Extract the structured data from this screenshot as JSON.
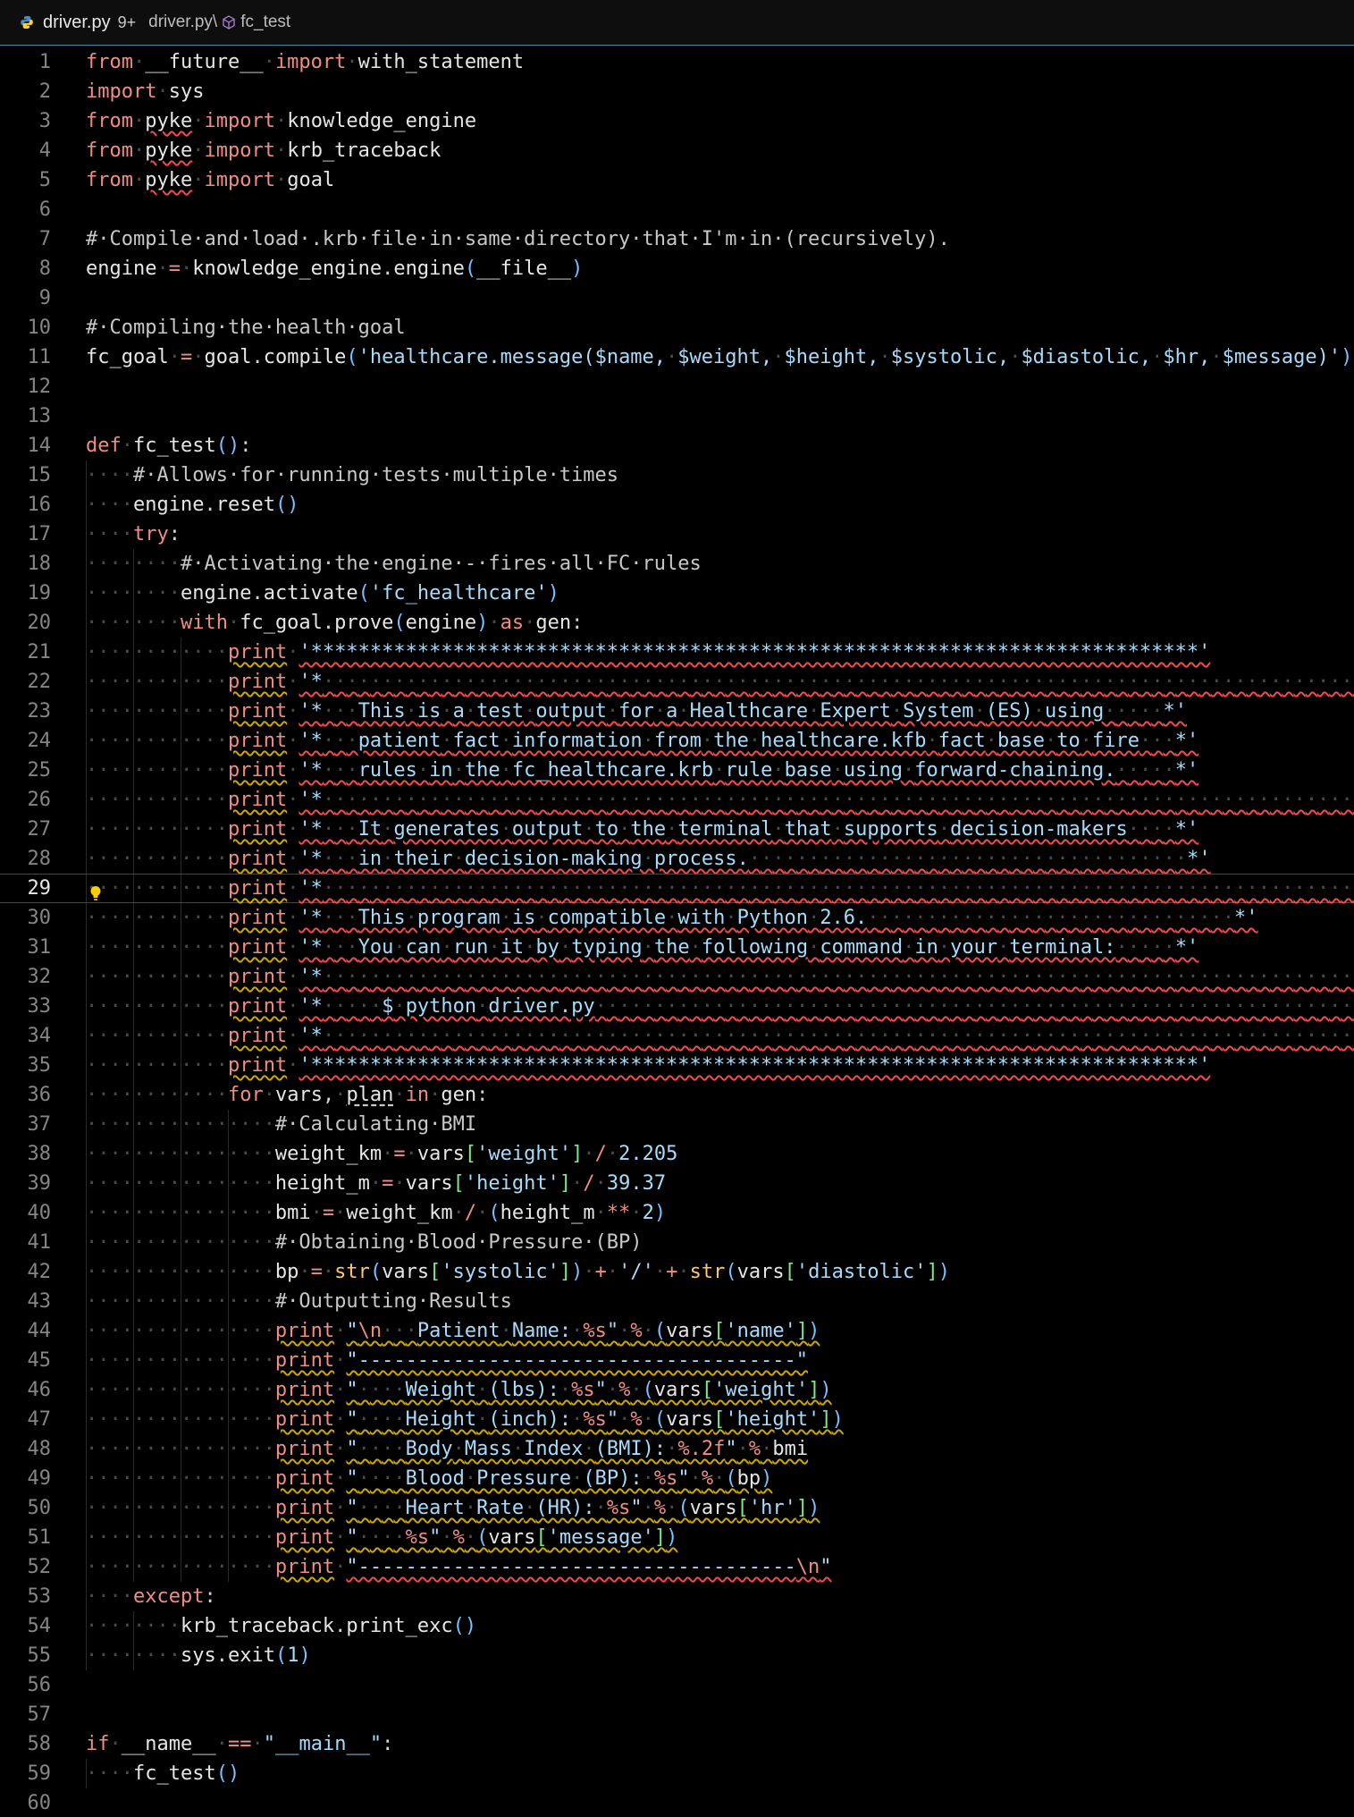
{
  "breadcrumb": {
    "file": "driver.py",
    "badge": "9+",
    "path": "driver.py\\",
    "symbol": "fc_test"
  },
  "editor": {
    "current_line": 29,
    "lines": [
      {
        "n": "1",
        "text": "from·__future__·import·with_statement"
      },
      {
        "n": "2",
        "text": "import·sys"
      },
      {
        "n": "3",
        "text": "from·pyke·import·knowledge_engine"
      },
      {
        "n": "4",
        "text": "from·pyke·import·krb_traceback"
      },
      {
        "n": "5",
        "text": "from·pyke·import·goal"
      },
      {
        "n": "6",
        "text": ""
      },
      {
        "n": "7",
        "text": "#·Compile·and·load·.krb·file·in·same·directory·that·I'm·in·(recursively)."
      },
      {
        "n": "8",
        "text": "engine·=·knowledge_engine.engine(__file__)"
      },
      {
        "n": "9",
        "text": ""
      },
      {
        "n": "10",
        "text": "#·Compiling·the·health·goal"
      },
      {
        "n": "11",
        "text": "fc_goal·=·goal.compile('healthcare.message($name,·$weight,·$height,·$systolic,·$diastolic,·$hr,·$message)')"
      },
      {
        "n": "12",
        "text": ""
      },
      {
        "n": "13",
        "text": ""
      },
      {
        "n": "14",
        "text": "def·fc_test():"
      },
      {
        "n": "15",
        "text": "····#·Allows·for·running·tests·multiple·times"
      },
      {
        "n": "16",
        "text": "····engine.reset()"
      },
      {
        "n": "17",
        "text": "····try:"
      },
      {
        "n": "18",
        "text": "········#·Activating·the·engine·-·fires·all·FC·rules"
      },
      {
        "n": "19",
        "text": "········engine.activate('fc_healthcare')"
      },
      {
        "n": "20",
        "text": "········with·fc_goal.prove(engine)·as·gen:"
      },
      {
        "n": "21",
        "text": "············print·'***************************************************************************'"
      },
      {
        "n": "22",
        "text": "············print·'*·························································································*'"
      },
      {
        "n": "23",
        "text": "············print·'*···This·is·a·test·output·for·a·Healthcare·Expert·System·(ES)·using·····*'"
      },
      {
        "n": "24",
        "text": "············print·'*···patient·fact·information·from·the·healthcare.kfb·fact·base·to·fire···*'"
      },
      {
        "n": "25",
        "text": "············print·'*···rules·in·the·fc_healthcare.krb·rule·base·using·forward-chaining.·····*'"
      },
      {
        "n": "26",
        "text": "············print·'*·························································································*'"
      },
      {
        "n": "27",
        "text": "············print·'*···It·generates·output·to·the·terminal·that·supports·decision-makers····*'"
      },
      {
        "n": "28",
        "text": "············print·'*···in·their·decision-making·process.·····································*'"
      },
      {
        "n": "29",
        "text": "············print·'*·························································································*'"
      },
      {
        "n": "30",
        "text": "············print·'*···This·program·is·compatible·with·Python·2.6.·······························*'"
      },
      {
        "n": "31",
        "text": "············print·'*···You·can·run·it·by·typing·the·following·command·in·your·terminal:·····*'"
      },
      {
        "n": "32",
        "text": "············print·'*·························································································*'"
      },
      {
        "n": "33",
        "text": "············print·'*·····$·python·driver.py·········································································*'"
      },
      {
        "n": "34",
        "text": "············print·'*·························································································*'"
      },
      {
        "n": "35",
        "text": "············print·'***************************************************************************'"
      },
      {
        "n": "36",
        "text": "············for·vars,·plan·in·gen:"
      },
      {
        "n": "37",
        "text": "················#·Calculating·BMI"
      },
      {
        "n": "38",
        "text": "················weight_km·=·vars['weight']·/·2.205"
      },
      {
        "n": "39",
        "text": "················height_m·=·vars['height']·/·39.37"
      },
      {
        "n": "40",
        "text": "················bmi·=·weight_km·/·(height_m·**·2)"
      },
      {
        "n": "41",
        "text": "················#·Obtaining·Blood·Pressure·(BP)"
      },
      {
        "n": "42",
        "text": "················bp·=·str(vars['systolic'])·+·'/'·+·str(vars['diastolic'])"
      },
      {
        "n": "43",
        "text": "················#·Outputting·Results"
      },
      {
        "n": "44",
        "text": "················print·\"\\n···Patient·Name:·%s\"·%·(vars['name'])"
      },
      {
        "n": "45",
        "text": "················print·\"-------------------------------------\""
      },
      {
        "n": "46",
        "text": "················print·\"····Weight·(lbs):·%s\"·%·(vars['weight'])"
      },
      {
        "n": "47",
        "text": "················print·\"····Height·(inch):·%s\"·%·(vars['height'])"
      },
      {
        "n": "48",
        "text": "················print·\"····Body·Mass·Index·(BMI):·%.2f\"·%·bmi"
      },
      {
        "n": "49",
        "text": "················print·\"····Blood·Pressure·(BP):·%s\"·%·(bp)"
      },
      {
        "n": "50",
        "text": "················print·\"····Heart·Rate·(HR):·%s\"·%·(vars['hr'])"
      },
      {
        "n": "51",
        "text": "················print·\"····%s\"·%·(vars['message'])"
      },
      {
        "n": "52",
        "text": "················print·\"-------------------------------------\\n\""
      },
      {
        "n": "53",
        "text": "····except:"
      },
      {
        "n": "54",
        "text": "········krb_traceback.print_exc()"
      },
      {
        "n": "55",
        "text": "········sys.exit(1)"
      },
      {
        "n": "56",
        "text": ""
      },
      {
        "n": "57",
        "text": ""
      },
      {
        "n": "58",
        "text": "if·__name__·==·\"__main__\":"
      },
      {
        "n": "59",
        "text": "····fc_test()"
      },
      {
        "n": "60",
        "text": ""
      }
    ]
  }
}
